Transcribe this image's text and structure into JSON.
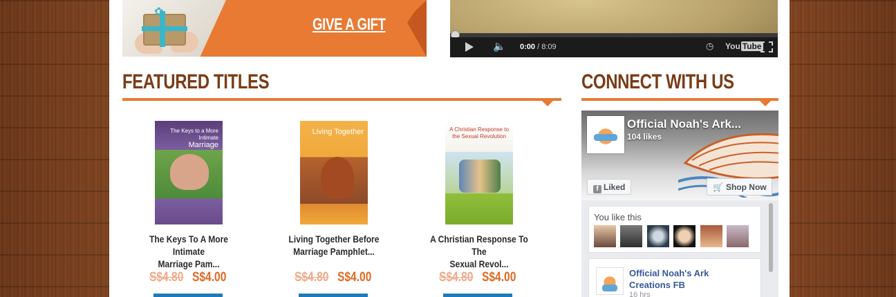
{
  "banner": {
    "gift_link": "GIVE A GIFT"
  },
  "video": {
    "current_time": "0:00",
    "duration": "/ 8:09",
    "provider": "You",
    "provider_tube": "Tube"
  },
  "featured": {
    "title": "FEATURED TITLES",
    "products": [
      {
        "name_line1": "The Keys To A More Intimate",
        "name_line2": "Marriage Pam...",
        "price_old": "S$4.80",
        "price_new": "S$4.00",
        "cover_small": "The Keys to a More Intimate",
        "cover_big": "Marriage",
        "cover_color": "#6a4b8c"
      },
      {
        "name_line1": "Living Together Before",
        "name_line2": "Marriage Pamphlet...",
        "price_old": "S$4.80",
        "price_new": "S$4.00",
        "cover_small": "Living Together",
        "cover_big": "",
        "cover_color": "#f0a93a"
      },
      {
        "name_line1": "A Christian Response To The",
        "name_line2": "Sexual Revol...",
        "price_old": "S$4.80",
        "price_new": "S$4.00",
        "cover_small": "A Christian Response to the Sexual Revolution",
        "cover_big": "",
        "cover_color": "#8fbf3a"
      }
    ]
  },
  "connect": {
    "title": "CONNECT WITH US",
    "fb": {
      "page_name": "Official Noah's Ark...",
      "likes": "104 likes",
      "liked_label": "Liked",
      "shop_label": "Shop Now",
      "you_like": "You like this",
      "post_name_line1": "Official Noah's Ark",
      "post_name_line2": "Creations FB",
      "post_time": "16 hrs"
    }
  },
  "colors": {
    "accent": "#e87a33",
    "heading": "#7a3c18",
    "fb_link": "#365899"
  }
}
